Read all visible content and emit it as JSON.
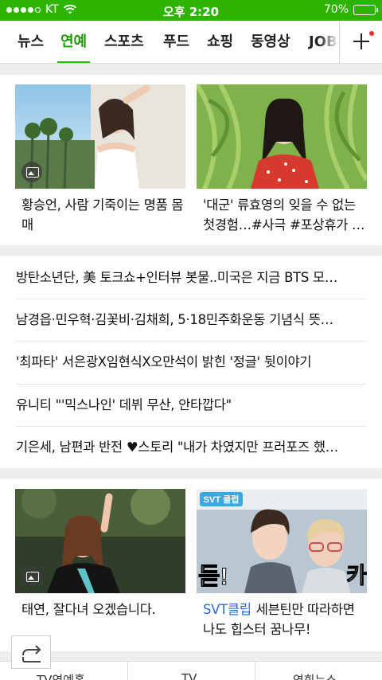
{
  "status_bar": {
    "carrier": "KT",
    "time": "오후 2:20",
    "battery": "70%",
    "battery_level": 0.7
  },
  "tabs": [
    {
      "label": "뉴스",
      "active": false
    },
    {
      "label": "연예",
      "active": true
    },
    {
      "label": "스포츠",
      "active": false
    },
    {
      "label": "푸드",
      "active": false
    },
    {
      "label": "쇼핑",
      "active": false
    },
    {
      "label": "동영상",
      "active": false
    },
    {
      "label": "JOB",
      "active": false
    }
  ],
  "top_cards": [
    {
      "title": "황승언, 사람 기죽이는 명품 몸매",
      "has_photo_icon": true
    },
    {
      "title": "'대군' 류효영의 잊을 수 없는 첫경험…#사극 #포상휴가 …",
      "has_photo_icon": false
    }
  ],
  "headlines": [
    "방탄소년단, 美 토크쇼+인터뷰 봇물..미국은 지금 BTS 모…",
    "남경읍·민우혁·김꽃비·김채희, 5·18민주화운동 기념식 뜻…",
    "'최파타' 서은광X임현식X오만석이 밝힌 '정글' 뒷이야기",
    "유니티 \"'믹스나인' 데뷔 무산, 안타깝다\"",
    "기은세, 남편과 반전 ♥스토리 \"내가 차였지만 프러포즈 했…"
  ],
  "bottom_cards": [
    {
      "title": "태연, 잘다녀 오겠습니다.",
      "has_photo_icon": true
    },
    {
      "accent": "SVT클립",
      "title": "세븐틴만 따라하면 나도 힙스터 꿈나무!",
      "thumb_text": "SVT 클럽"
    }
  ],
  "bottom_tabs": [
    "TV연예홈",
    "TV",
    "연회뉴스"
  ],
  "colors": {
    "brand": "#2db400",
    "accent_link": "#2b6bd6",
    "notification": "#ff2a2a"
  },
  "icons": {
    "share": "share-icon",
    "add": "plus-icon",
    "photo": "photo-icon"
  }
}
